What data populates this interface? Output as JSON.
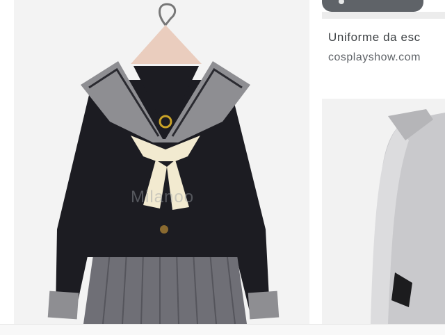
{
  "results": [
    {
      "image_alt": "Black sailor school uniform with grey collar, cream scarf and pleated grey skirt",
      "watermark": "Milanoo"
    },
    {
      "title": "Uniforme da esc",
      "source": "cosplayshow.com",
      "image_alt": "Grey jacket with black bow"
    }
  ],
  "colors": {
    "uniform_black": "#1c1c22",
    "collar_grey": "#8e8e92",
    "skirt_grey": "#6f6f76",
    "scarf_cream": "#f2ead0",
    "badge_gold": "#c9a227"
  },
  "icons": {
    "chip": "chevron-icon"
  }
}
